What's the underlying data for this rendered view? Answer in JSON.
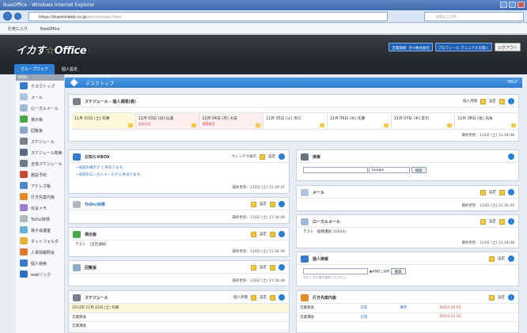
{
  "window": {
    "title": "IkaeOffice - Windows Internet Explorer"
  },
  "browser": {
    "url_main": "https://ikaohotweb.co.jp",
    "url_rest": "/demo/index.html",
    "search_placeholder": "BING.COM",
    "favorites_label": "お気に入り",
    "fav_item": "IkaeOffice"
  },
  "header": {
    "logo_a": "イカす",
    "logo_star": "☆",
    "logo_b": "Office",
    "btn_company": "営業部様 ​ 子ㅌ株式会社",
    "btn_manual": "プロフィール マニュアルを開く",
    "logout": "ログアウト"
  },
  "tabs": [
    {
      "label": "グループウェア"
    },
    {
      "label": "個人設定"
    }
  ],
  "sidebar": {
    "menu_label": "MENU",
    "items": [
      {
        "label": "デスクトップ",
        "icon": "home-icon",
        "color": "#3a78c8"
      },
      {
        "label": "メール",
        "icon": "mail-icon",
        "color": "#b0c4de"
      },
      {
        "label": "ローカルメール",
        "icon": "local-mail-icon",
        "color": "#9fb8d6"
      },
      {
        "label": "掲示板",
        "icon": "board-icon",
        "color": "#4aa84a"
      },
      {
        "label": "回覧板",
        "icon": "circular-icon",
        "color": "#8fa9c9"
      },
      {
        "label": "スケジュール",
        "icon": "schedule-icon",
        "color": "#7a7f8c"
      },
      {
        "label": "スケジュール検索",
        "icon": "schedule-search-icon",
        "color": "#5a6a85"
      },
      {
        "label": "全体スケジュール",
        "icon": "all-schedule-icon",
        "color": "#6c7a8e"
      },
      {
        "label": "施設予約",
        "icon": "facility-icon",
        "color": "#c84a2f"
      },
      {
        "label": "アドレス帳",
        "icon": "address-book-icon",
        "color": "#4f86c6"
      },
      {
        "label": "行き先案内板",
        "icon": "destination-icon",
        "color": "#e08a2c"
      },
      {
        "label": "伝言メモ",
        "icon": "memo-icon",
        "color": "#9b7cc7"
      },
      {
        "label": "ToDo/目標",
        "icon": "todo-icon",
        "color": "#b0b8c4"
      },
      {
        "label": "電子会議室",
        "icon": "conference-icon",
        "color": "#6ab0d8"
      },
      {
        "label": "ネットフォルダ",
        "icon": "folder-icon",
        "color": "#e3b43c"
      },
      {
        "label": "人事情報照会",
        "icon": "personnel-icon",
        "color": "#e07a2c"
      },
      {
        "label": "個人検索",
        "icon": "person-search-icon",
        "color": "#3a78c8"
      },
      {
        "label": "webリンク",
        "icon": "web-link-icon",
        "color": "#2e6fbf"
      }
    ]
  },
  "page": {
    "title": "デスクトップ",
    "help": "HELP"
  },
  "common": {
    "settings": "設定",
    "personal_month": "個人月間",
    "window_view": "ウィンドウ表示"
  },
  "schedule_panel": {
    "title": "スケジュール - 個人週間(週)",
    "updated": "最終更新：11/02 (土) 11:34:48",
    "days": [
      {
        "label": "11月 02日 (土) 先勝",
        "sub": ""
      },
      {
        "label": "11月 03日 (日) 仏滅",
        "sub": "文化の日"
      },
      {
        "label": "11月 04日 (月) 大安",
        "sub": "振替休日"
      },
      {
        "label": "11月 05日 (火) 赤口",
        "sub": ""
      },
      {
        "label": "11月 06日 (水) 先勝",
        "sub": ""
      },
      {
        "label": "11月 07日 (木) 友引",
        "sub": ""
      },
      {
        "label": "11月 08日 (金) 先負",
        "sub": ""
      }
    ]
  },
  "notice_panel": {
    "title": "お知らせBOX",
    "line1": "・未読の掲示が 1 件あります。",
    "line2": "・未読のローカルメールが 1 件あります。",
    "updated": "最終更新：11/02 (土) 11:34:47"
  },
  "todo_panel": {
    "title": "ToDo/目標",
    "updated": "最終更新：11/02 (土) 11:34:48"
  },
  "board_panel": {
    "title": "掲示板",
    "item": "テスト　［全社通知］",
    "updated": "最終更新：11/02 (土) 11:34:49"
  },
  "circular_panel": {
    "title": "回覧板",
    "updated": "最終更新：11/02 (土) 11:34:48"
  },
  "schedule2_panel": {
    "title": "スケジュール",
    "date_row": "2013年 11月 02日 (土) 先勝",
    "rows": [
      "営業部長",
      "営業課長"
    ]
  },
  "search_panel": {
    "title": "検索",
    "engine": "Google",
    "button": "検索"
  },
  "mail_panel": {
    "title": "メール",
    "updated": "最終更新：11/02 (土) 11:34:49"
  },
  "localmail_panel": {
    "title": "ローカルメール",
    "item_subject": "テスト",
    "item_from": "総務課長 (10/24)",
    "updated": "最終更新：11/02 (土) 11:34:48"
  },
  "person_panel": {
    "title": "個人検索",
    "and": "AND",
    "or": "OR",
    "button": "検索",
    "hint": "※未入力の場合検索されません"
  },
  "dest_panel": {
    "title": "行き先案内板",
    "rows": [
      {
        "name": "営業部長",
        "status": "在席",
        "extra": "帰宅",
        "time": "10/24 12:25"
      },
      {
        "name": "営業課長",
        "status": "在席",
        "extra": "",
        "time": "10/24 12:25"
      }
    ]
  }
}
